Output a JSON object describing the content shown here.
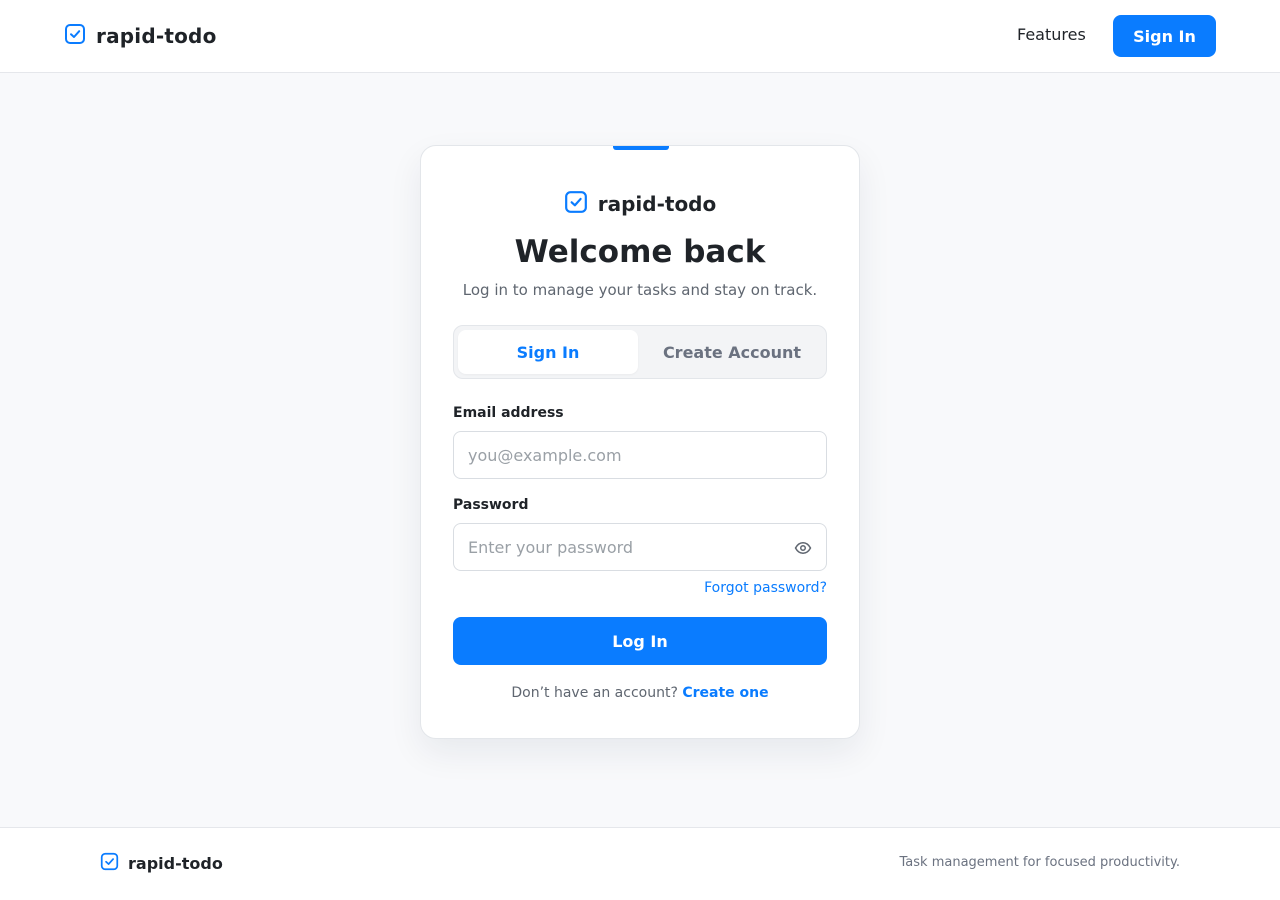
{
  "header": {
    "brand": "rapid-todo",
    "nav_features": "Features",
    "sign_in": "Sign In"
  },
  "card": {
    "brand": "rapid-todo",
    "title": "Welcome back",
    "subtitle": "Log in to manage your tasks and stay on track.",
    "tabs": [
      {
        "label": "Sign In",
        "active": true
      },
      {
        "label": "Create Account",
        "active": false
      }
    ],
    "email": {
      "label": "Email address",
      "value": "",
      "placeholder": "you@example.com"
    },
    "password": {
      "label": "Password",
      "value": "",
      "placeholder": "Enter your password"
    },
    "forgot": "Forgot password?",
    "login_button": "Log In",
    "no_account_text": "Don’t have an account?",
    "create_link": "Create one"
  },
  "footer": {
    "brand": "rapid-todo",
    "tagline": "Task management for focused productivity."
  },
  "icons": {
    "brand": "check-square-icon",
    "password_toggle": "eye-icon"
  },
  "colors": {
    "accent": "#0a7cff",
    "text": "#1f2328",
    "muted": "#5f6670",
    "background": "#f8f9fb"
  }
}
